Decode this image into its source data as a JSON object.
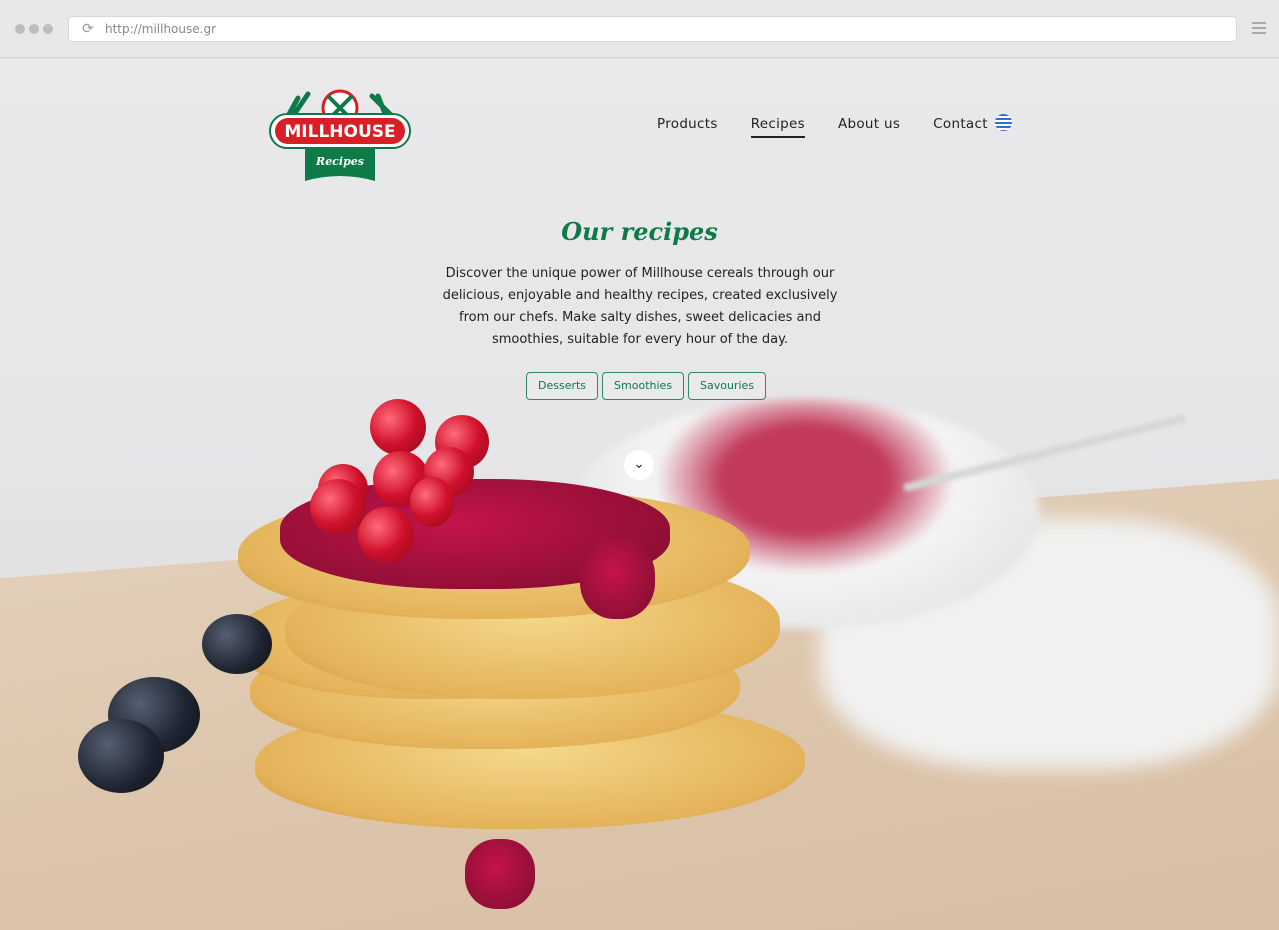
{
  "browser": {
    "url": "http://millhouse.gr"
  },
  "logo": {
    "brand": "MILLHOUSE",
    "sub": "Recipes"
  },
  "nav": {
    "items": [
      {
        "label": "Products"
      },
      {
        "label": "Recipes"
      },
      {
        "label": "About us"
      },
      {
        "label": "Contact"
      }
    ],
    "active": "Recipes",
    "language_icon": "greek-flag-icon"
  },
  "hero": {
    "title": "Our recipes",
    "description": "Discover the unique power of Millhouse cereals through our delicious, enjoyable and healthy recipes, created exclusively from our chefs. Make salty dishes, sweet delicacies and smoothies, suitable for every hour of the day.",
    "tags": [
      {
        "label": "Desserts"
      },
      {
        "label": "Smoothies"
      },
      {
        "label": "Savouries"
      }
    ],
    "scroll_icon": "chevron-down-icon"
  },
  "colors": {
    "brand_green": "#0d7a48",
    "brand_red": "#d71f26"
  }
}
